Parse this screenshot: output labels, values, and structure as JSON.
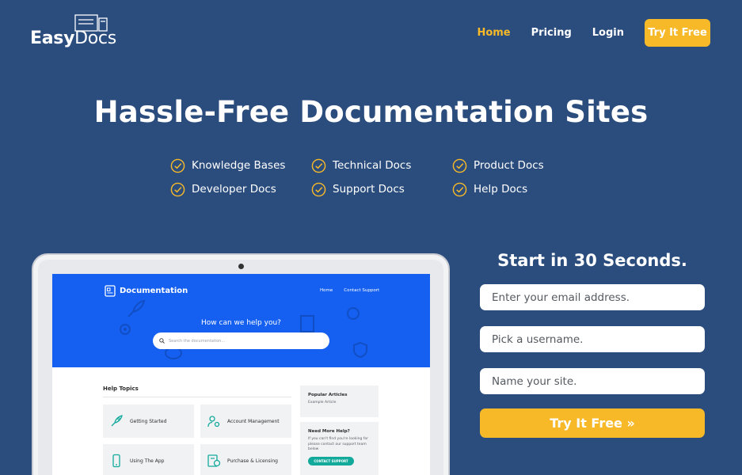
{
  "brand": {
    "logo_bold": "Easy",
    "logo_light": "Docs"
  },
  "nav": {
    "home": "Home",
    "pricing": "Pricing",
    "login": "Login",
    "cta": "Try It Free"
  },
  "hero": {
    "title": "Hassle-Free Documentation Sites",
    "features": [
      "Knowledge Bases",
      "Technical Docs",
      "Product Docs",
      "Developer Docs",
      "Support Docs",
      "Help Docs"
    ]
  },
  "preview": {
    "brand": "Documentation",
    "nav": [
      "Home",
      "Contact Support"
    ],
    "ask": "How can we help you?",
    "search_placeholder": "Search the documentation...",
    "help_topics": "Help Topics",
    "topics": [
      "Getting Started",
      "Account Management",
      "Using The App",
      "Purchase & Licensing"
    ],
    "popular_title": "Popular Articles",
    "popular_item": "Example Article",
    "need_help_title": "Need More Help?",
    "need_help_text": "If you can't find you're looking for please contact our support team below",
    "contact_button": "CONTACT SUPPORT"
  },
  "signup": {
    "title": "Start in 30 Seconds.",
    "email_placeholder": "Enter your email address.",
    "username_placeholder": "Pick a username.",
    "site_placeholder": "Name your site.",
    "button": "Try It Free »"
  },
  "colors": {
    "background": "#2b4d7e",
    "accent": "#f7b928",
    "preview_blue": "#1560f1",
    "teal": "#13aa9c"
  }
}
